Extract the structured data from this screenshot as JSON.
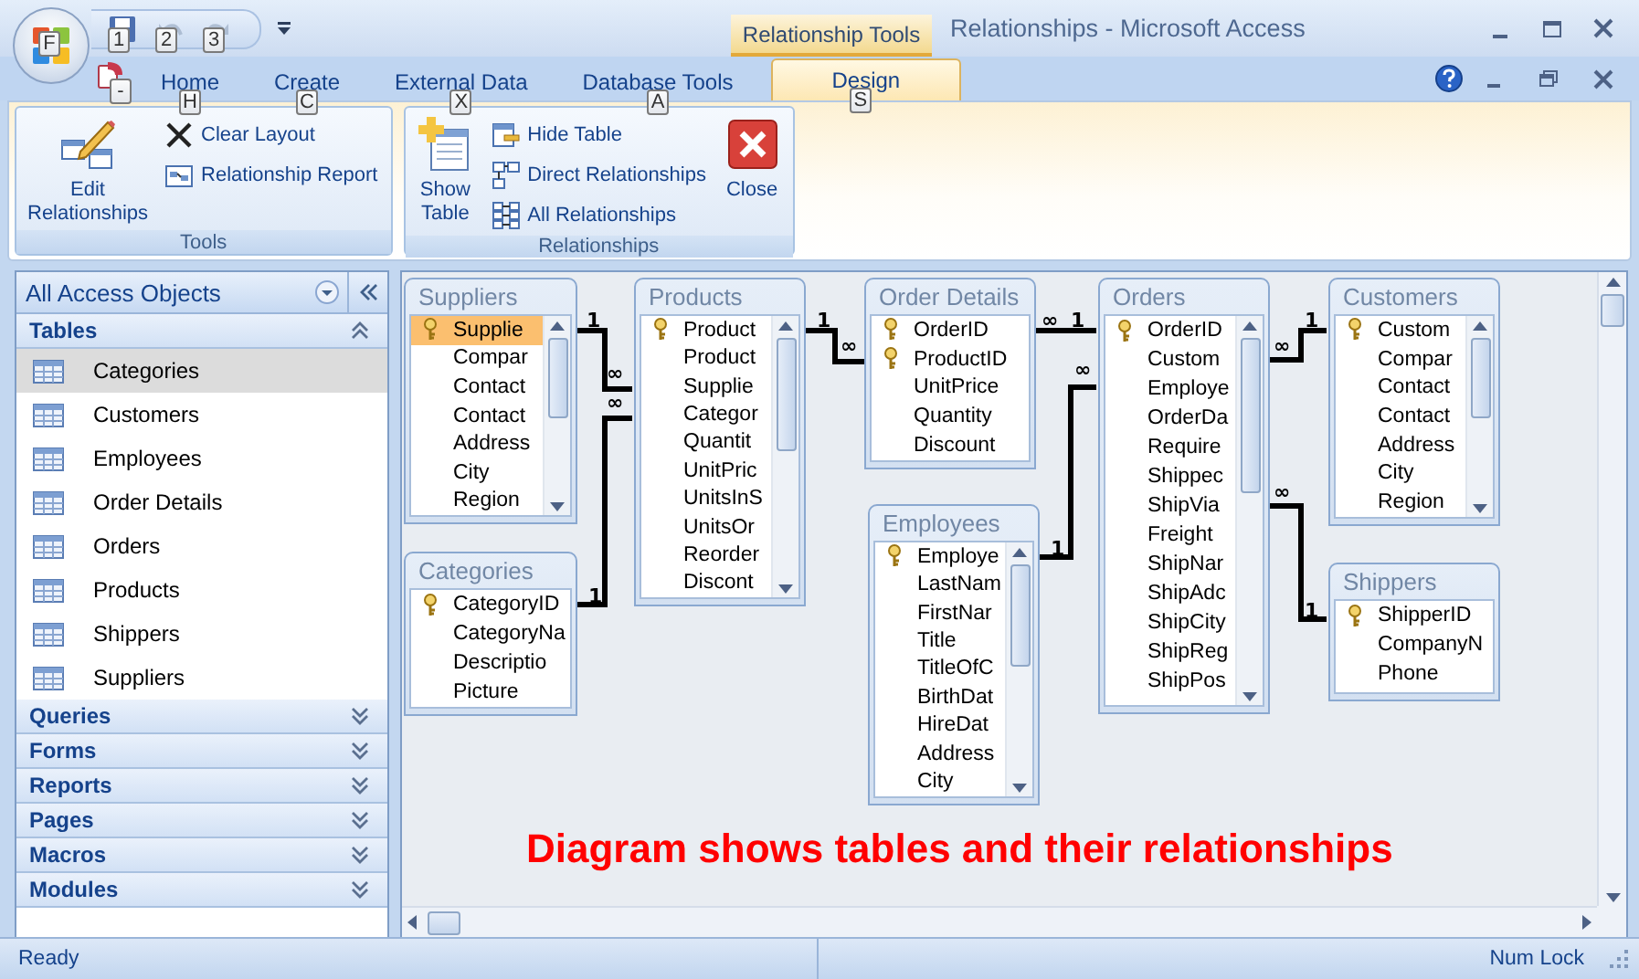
{
  "window": {
    "title": "Relationships - Microsoft Access",
    "contextual_tab": "Relationship Tools"
  },
  "office_button": {
    "keytip": "F"
  },
  "quick_access": [
    {
      "kind": "save",
      "keytip": "1",
      "disabled": false
    },
    {
      "kind": "undo",
      "keytip": "2",
      "disabled": true
    },
    {
      "kind": "redo",
      "keytip": "3",
      "disabled": true
    }
  ],
  "document_icon": {
    "keytip": "-"
  },
  "tabs": [
    {
      "label": "Home",
      "keytip": "H",
      "selected": false
    },
    {
      "label": "Create",
      "keytip": "C",
      "selected": false
    },
    {
      "label": "External Data",
      "keytip": "X",
      "selected": false
    },
    {
      "label": "Database Tools",
      "keytip": "A",
      "selected": false
    },
    {
      "label": "Design",
      "keytip": "S",
      "selected": true
    }
  ],
  "ribbon": {
    "groups": [
      {
        "label": "Tools",
        "buttons": [
          {
            "kind": "large",
            "label": "Edit Relationships"
          },
          {
            "kind": "small",
            "label": "Clear Layout"
          },
          {
            "kind": "small",
            "label": "Relationship Report"
          }
        ]
      },
      {
        "label": "Relationships",
        "buttons": [
          {
            "kind": "large",
            "label": "Show Table"
          },
          {
            "kind": "small",
            "label": "Hide Table"
          },
          {
            "kind": "small",
            "label": "Direct Relationships"
          },
          {
            "kind": "small",
            "label": "All Relationships"
          },
          {
            "kind": "large",
            "label": "Close"
          }
        ]
      }
    ]
  },
  "navigation": {
    "title": "All Access Objects",
    "groups": [
      {
        "label": "Tables",
        "expanded": true,
        "items": [
          {
            "label": "Categories",
            "selected": true
          },
          {
            "label": "Customers",
            "selected": false
          },
          {
            "label": "Employees",
            "selected": false
          },
          {
            "label": "Order Details",
            "selected": false
          },
          {
            "label": "Orders",
            "selected": false
          },
          {
            "label": "Products",
            "selected": false
          },
          {
            "label": "Shippers",
            "selected": false
          },
          {
            "label": "Suppliers",
            "selected": false
          }
        ]
      },
      {
        "label": "Queries",
        "expanded": false
      },
      {
        "label": "Forms",
        "expanded": false
      },
      {
        "label": "Reports",
        "expanded": false
      },
      {
        "label": "Pages",
        "expanded": false
      },
      {
        "label": "Macros",
        "expanded": false
      },
      {
        "label": "Modules",
        "expanded": false
      }
    ]
  },
  "diagram": {
    "tables": [
      {
        "name": "Suppliers",
        "scrollable": true,
        "fields": [
          {
            "name": "Supplie",
            "key": true,
            "selected": true
          },
          {
            "name": "Compar",
            "key": false,
            "selected": false
          },
          {
            "name": "Contact",
            "key": false,
            "selected": false
          },
          {
            "name": "Contact",
            "key": false,
            "selected": false
          },
          {
            "name": "Address",
            "key": false,
            "selected": false
          },
          {
            "name": "City",
            "key": false,
            "selected": false
          },
          {
            "name": "Region",
            "key": false,
            "selected": false
          }
        ]
      },
      {
        "name": "Products",
        "scrollable": true,
        "fields": [
          {
            "name": "Product",
            "key": true,
            "selected": false
          },
          {
            "name": "Product",
            "key": false,
            "selected": false
          },
          {
            "name": "Supplie",
            "key": false,
            "selected": false
          },
          {
            "name": "Categor",
            "key": false,
            "selected": false
          },
          {
            "name": "Quantit",
            "key": false,
            "selected": false
          },
          {
            "name": "UnitPric",
            "key": false,
            "selected": false
          },
          {
            "name": "UnitsInS",
            "key": false,
            "selected": false
          },
          {
            "name": "UnitsOr",
            "key": false,
            "selected": false
          },
          {
            "name": "Reorder",
            "key": false,
            "selected": false
          },
          {
            "name": "Discont",
            "key": false,
            "selected": false
          }
        ]
      },
      {
        "name": "Order Details",
        "scrollable": false,
        "fields": [
          {
            "name": "OrderID",
            "key": true,
            "selected": false
          },
          {
            "name": "ProductID",
            "key": true,
            "selected": false
          },
          {
            "name": "UnitPrice",
            "key": false,
            "selected": false
          },
          {
            "name": "Quantity",
            "key": false,
            "selected": false
          },
          {
            "name": "Discount",
            "key": false,
            "selected": false
          }
        ]
      },
      {
        "name": "Orders",
        "scrollable": true,
        "fields": [
          {
            "name": "OrderID",
            "key": true,
            "selected": false
          },
          {
            "name": "Custom",
            "key": false,
            "selected": false
          },
          {
            "name": "Employe",
            "key": false,
            "selected": false
          },
          {
            "name": "OrderDa",
            "key": false,
            "selected": false
          },
          {
            "name": "Require",
            "key": false,
            "selected": false
          },
          {
            "name": "Shippec",
            "key": false,
            "selected": false
          },
          {
            "name": "ShipVia",
            "key": false,
            "selected": false
          },
          {
            "name": "Freight",
            "key": false,
            "selected": false
          },
          {
            "name": "ShipNar",
            "key": false,
            "selected": false
          },
          {
            "name": "ShipAdc",
            "key": false,
            "selected": false
          },
          {
            "name": "ShipCity",
            "key": false,
            "selected": false
          },
          {
            "name": "ShipReg",
            "key": false,
            "selected": false
          },
          {
            "name": "ShipPos",
            "key": false,
            "selected": false
          }
        ]
      },
      {
        "name": "Customers",
        "scrollable": true,
        "fields": [
          {
            "name": "Custom",
            "key": true,
            "selected": false
          },
          {
            "name": "Compar",
            "key": false,
            "selected": false
          },
          {
            "name": "Contact",
            "key": false,
            "selected": false
          },
          {
            "name": "Contact",
            "key": false,
            "selected": false
          },
          {
            "name": "Address",
            "key": false,
            "selected": false
          },
          {
            "name": "City",
            "key": false,
            "selected": false
          },
          {
            "name": "Region",
            "key": false,
            "selected": false
          }
        ]
      },
      {
        "name": "Categories",
        "scrollable": false,
        "fields": [
          {
            "name": "CategoryID",
            "key": true,
            "selected": false
          },
          {
            "name": "CategoryNa",
            "key": false,
            "selected": false
          },
          {
            "name": "Descriptio",
            "key": false,
            "selected": false
          },
          {
            "name": "Picture",
            "key": false,
            "selected": false
          }
        ]
      },
      {
        "name": "Employees",
        "scrollable": true,
        "fields": [
          {
            "name": "Employe",
            "key": true,
            "selected": false
          },
          {
            "name": "LastNam",
            "key": false,
            "selected": false
          },
          {
            "name": "FirstNar",
            "key": false,
            "selected": false
          },
          {
            "name": "Title",
            "key": false,
            "selected": false
          },
          {
            "name": "TitleOfC",
            "key": false,
            "selected": false
          },
          {
            "name": "BirthDat",
            "key": false,
            "selected": false
          },
          {
            "name": "HireDat",
            "key": false,
            "selected": false
          },
          {
            "name": "Address",
            "key": false,
            "selected": false
          },
          {
            "name": "City",
            "key": false,
            "selected": false
          }
        ]
      },
      {
        "name": "Shippers",
        "scrollable": false,
        "fields": [
          {
            "name": "ShipperID",
            "key": true,
            "selected": false
          },
          {
            "name": "CompanyN",
            "key": false,
            "selected": false
          },
          {
            "name": "Phone",
            "key": false,
            "selected": false
          }
        ]
      }
    ],
    "relationships": [
      {
        "one": "1",
        "many": "∞"
      },
      {
        "one": "1",
        "many": "∞"
      },
      {
        "one": "1",
        "many": "∞"
      },
      {
        "one": "1",
        "many": "∞"
      },
      {
        "one": "1",
        "many": "∞"
      },
      {
        "one": "1",
        "many": "∞"
      },
      {
        "one": "1",
        "many": "∞"
      }
    ],
    "caption": "Diagram shows tables and their relationships"
  },
  "status_bar": {
    "message": "Ready",
    "indicators": [
      "Num Lock"
    ]
  }
}
